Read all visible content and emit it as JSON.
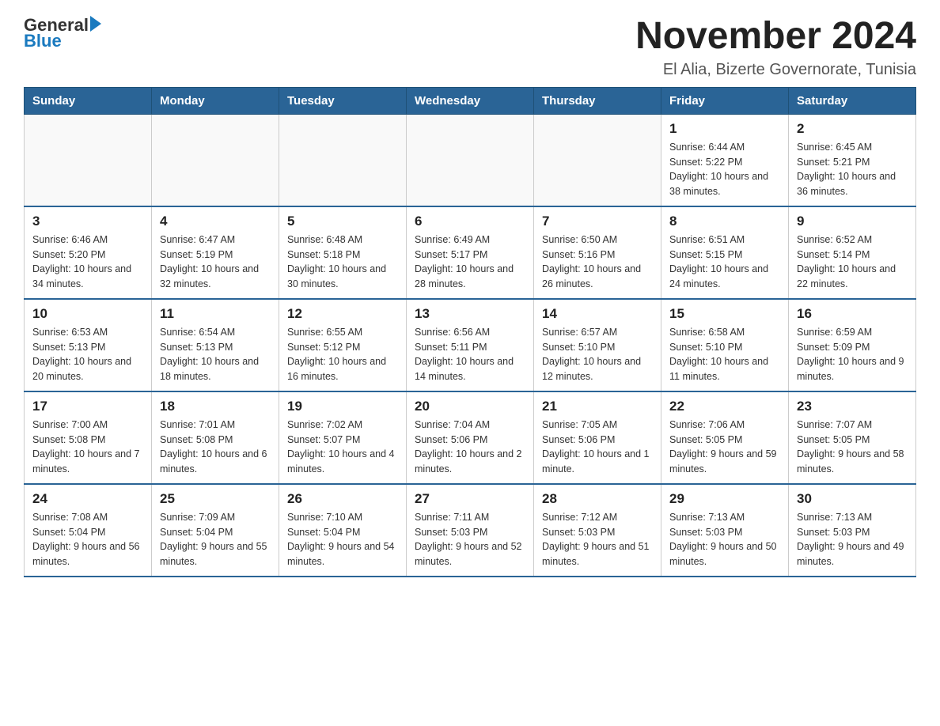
{
  "header": {
    "logo_text_general": "General",
    "logo_text_blue": "Blue",
    "month_title": "November 2024",
    "location": "El Alia, Bizerte Governorate, Tunisia"
  },
  "days_of_week": [
    "Sunday",
    "Monday",
    "Tuesday",
    "Wednesday",
    "Thursday",
    "Friday",
    "Saturday"
  ],
  "weeks": [
    [
      {
        "day": "",
        "info": ""
      },
      {
        "day": "",
        "info": ""
      },
      {
        "day": "",
        "info": ""
      },
      {
        "day": "",
        "info": ""
      },
      {
        "day": "",
        "info": ""
      },
      {
        "day": "1",
        "info": "Sunrise: 6:44 AM\nSunset: 5:22 PM\nDaylight: 10 hours and 38 minutes."
      },
      {
        "day": "2",
        "info": "Sunrise: 6:45 AM\nSunset: 5:21 PM\nDaylight: 10 hours and 36 minutes."
      }
    ],
    [
      {
        "day": "3",
        "info": "Sunrise: 6:46 AM\nSunset: 5:20 PM\nDaylight: 10 hours and 34 minutes."
      },
      {
        "day": "4",
        "info": "Sunrise: 6:47 AM\nSunset: 5:19 PM\nDaylight: 10 hours and 32 minutes."
      },
      {
        "day": "5",
        "info": "Sunrise: 6:48 AM\nSunset: 5:18 PM\nDaylight: 10 hours and 30 minutes."
      },
      {
        "day": "6",
        "info": "Sunrise: 6:49 AM\nSunset: 5:17 PM\nDaylight: 10 hours and 28 minutes."
      },
      {
        "day": "7",
        "info": "Sunrise: 6:50 AM\nSunset: 5:16 PM\nDaylight: 10 hours and 26 minutes."
      },
      {
        "day": "8",
        "info": "Sunrise: 6:51 AM\nSunset: 5:15 PM\nDaylight: 10 hours and 24 minutes."
      },
      {
        "day": "9",
        "info": "Sunrise: 6:52 AM\nSunset: 5:14 PM\nDaylight: 10 hours and 22 minutes."
      }
    ],
    [
      {
        "day": "10",
        "info": "Sunrise: 6:53 AM\nSunset: 5:13 PM\nDaylight: 10 hours and 20 minutes."
      },
      {
        "day": "11",
        "info": "Sunrise: 6:54 AM\nSunset: 5:13 PM\nDaylight: 10 hours and 18 minutes."
      },
      {
        "day": "12",
        "info": "Sunrise: 6:55 AM\nSunset: 5:12 PM\nDaylight: 10 hours and 16 minutes."
      },
      {
        "day": "13",
        "info": "Sunrise: 6:56 AM\nSunset: 5:11 PM\nDaylight: 10 hours and 14 minutes."
      },
      {
        "day": "14",
        "info": "Sunrise: 6:57 AM\nSunset: 5:10 PM\nDaylight: 10 hours and 12 minutes."
      },
      {
        "day": "15",
        "info": "Sunrise: 6:58 AM\nSunset: 5:10 PM\nDaylight: 10 hours and 11 minutes."
      },
      {
        "day": "16",
        "info": "Sunrise: 6:59 AM\nSunset: 5:09 PM\nDaylight: 10 hours and 9 minutes."
      }
    ],
    [
      {
        "day": "17",
        "info": "Sunrise: 7:00 AM\nSunset: 5:08 PM\nDaylight: 10 hours and 7 minutes."
      },
      {
        "day": "18",
        "info": "Sunrise: 7:01 AM\nSunset: 5:08 PM\nDaylight: 10 hours and 6 minutes."
      },
      {
        "day": "19",
        "info": "Sunrise: 7:02 AM\nSunset: 5:07 PM\nDaylight: 10 hours and 4 minutes."
      },
      {
        "day": "20",
        "info": "Sunrise: 7:04 AM\nSunset: 5:06 PM\nDaylight: 10 hours and 2 minutes."
      },
      {
        "day": "21",
        "info": "Sunrise: 7:05 AM\nSunset: 5:06 PM\nDaylight: 10 hours and 1 minute."
      },
      {
        "day": "22",
        "info": "Sunrise: 7:06 AM\nSunset: 5:05 PM\nDaylight: 9 hours and 59 minutes."
      },
      {
        "day": "23",
        "info": "Sunrise: 7:07 AM\nSunset: 5:05 PM\nDaylight: 9 hours and 58 minutes."
      }
    ],
    [
      {
        "day": "24",
        "info": "Sunrise: 7:08 AM\nSunset: 5:04 PM\nDaylight: 9 hours and 56 minutes."
      },
      {
        "day": "25",
        "info": "Sunrise: 7:09 AM\nSunset: 5:04 PM\nDaylight: 9 hours and 55 minutes."
      },
      {
        "day": "26",
        "info": "Sunrise: 7:10 AM\nSunset: 5:04 PM\nDaylight: 9 hours and 54 minutes."
      },
      {
        "day": "27",
        "info": "Sunrise: 7:11 AM\nSunset: 5:03 PM\nDaylight: 9 hours and 52 minutes."
      },
      {
        "day": "28",
        "info": "Sunrise: 7:12 AM\nSunset: 5:03 PM\nDaylight: 9 hours and 51 minutes."
      },
      {
        "day": "29",
        "info": "Sunrise: 7:13 AM\nSunset: 5:03 PM\nDaylight: 9 hours and 50 minutes."
      },
      {
        "day": "30",
        "info": "Sunrise: 7:13 AM\nSunset: 5:03 PM\nDaylight: 9 hours and 49 minutes."
      }
    ]
  ]
}
